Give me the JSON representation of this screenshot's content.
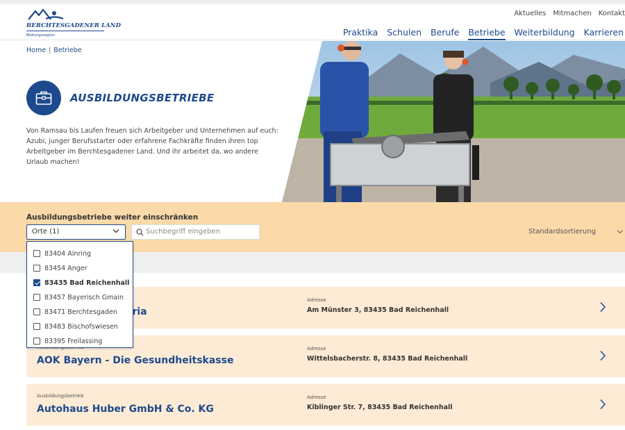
{
  "header": {
    "logo": {
      "title": "BERCHTESGADENER LAND",
      "subtitle": "Bildungsregion"
    },
    "secondary_nav": [
      "Aktuelles",
      "Mitmachen",
      "Kontakt"
    ],
    "main_nav": [
      "Praktika",
      "Schulen",
      "Berufe",
      "Betriebe",
      "Weiterbildung",
      "Karrieren"
    ],
    "active_nav": "Betriebe"
  },
  "breadcrumb": [
    "Home",
    "Betriebe"
  ],
  "hero": {
    "title": "AUSBILDUNGSBETRIEBE",
    "text": "Von Ramsau bis Laufen freuen sich Arbeitgeber und Unternehmen auf euch: Azubi, junger Berufsstarter oder erfahrene Fachkräfte finden ihren top Arbeitgeber im Berchtesgadener Land. Und ihr arbeitet da, wo andere Urlaub machen!"
  },
  "filter": {
    "label": "Ausbildungsbetriebe weiter einschränken",
    "select_value": "Orte (1)",
    "search_placeholder": "Suchbegriff eingeben",
    "sort_label": "Standardsortierung",
    "options": [
      {
        "label": "83404 Ainring",
        "checked": false
      },
      {
        "label": "83454 Anger",
        "checked": false
      },
      {
        "label": "83435 Bad Reichenhall",
        "checked": true
      },
      {
        "label": "83457 Bayerisch Gmain",
        "checked": false
      },
      {
        "label": "83471 Berchtesgaden",
        "checked": false
      },
      {
        "label": "83483 Bischofswiesen",
        "checked": false
      },
      {
        "label": "83395 Freilassing",
        "checked": false
      }
    ]
  },
  "results": [
    {
      "type": "Ausbildungsbetrieb",
      "name": "aria",
      "address_label": "Adresse",
      "address": "Am Münster 3, 83435 Bad Reichenhall"
    },
    {
      "type": "Ausbildungsbetrieb",
      "name": "AOK Bayern - Die Gesundheitskasse",
      "address_label": "Adresse",
      "address": "Wittelsbacherstr. 8, 83435 Bad Reichenhall"
    },
    {
      "type": "Ausbildungsbetrieb",
      "name": "Autohaus Huber GmbH & Co. KG",
      "address_label": "Adresse",
      "address": "Kiblinger Str. 7, 83435 Bad Reichenhall"
    }
  ],
  "colors": {
    "brand_blue": "#1d4a8c",
    "filter_band": "#fbd9a9",
    "card_bg": "#fdebd6",
    "gray_band": "#efefef"
  },
  "icons": {
    "hero": "briefcase-icon",
    "search": "search-icon",
    "select": "chevron-down-icon",
    "card": "chevron-right-icon"
  }
}
